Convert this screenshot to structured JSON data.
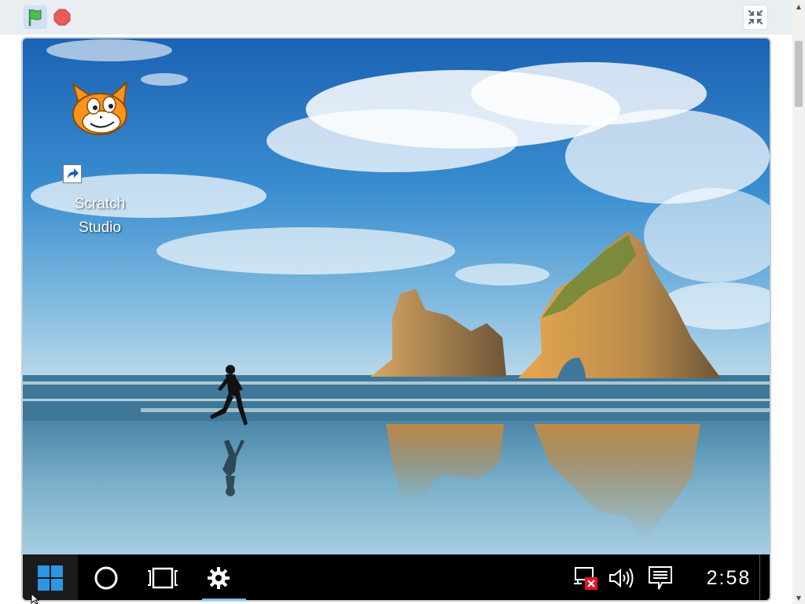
{
  "toolbar": {
    "green_flag": {
      "icon": "green-flag-icon",
      "color": "#4cbf56"
    },
    "stop": {
      "icon": "stop-sign-icon",
      "color": "#ec5959"
    },
    "fullscreen": {
      "icon": "shrink-fullscreen-icon"
    }
  },
  "stage": {
    "wallpaper": {
      "description_icon": "windows-beach-wallpaper",
      "sky_color": "#1e72c8",
      "sea_color": "#5a9cc0"
    },
    "desktop": {
      "icons": [
        {
          "label_line1": "Scratch",
          "label_line2": "Studio",
          "icon": "scratch-cat-icon",
          "shortcut_icon": "shortcut-arrow-icon"
        }
      ]
    },
    "taskbar": {
      "start_icon": "windows-logo-icon",
      "search_icon": "cortana-circle-icon",
      "taskview_icon": "task-view-icon",
      "pinned_app_icon": "gear-icon",
      "tray": {
        "network_icon": "network-disconnected-icon",
        "volume_icon": "volume-icon",
        "action_center_icon": "notification-icon"
      },
      "clock": "2:58",
      "accent_color": "#76b9ed"
    }
  }
}
